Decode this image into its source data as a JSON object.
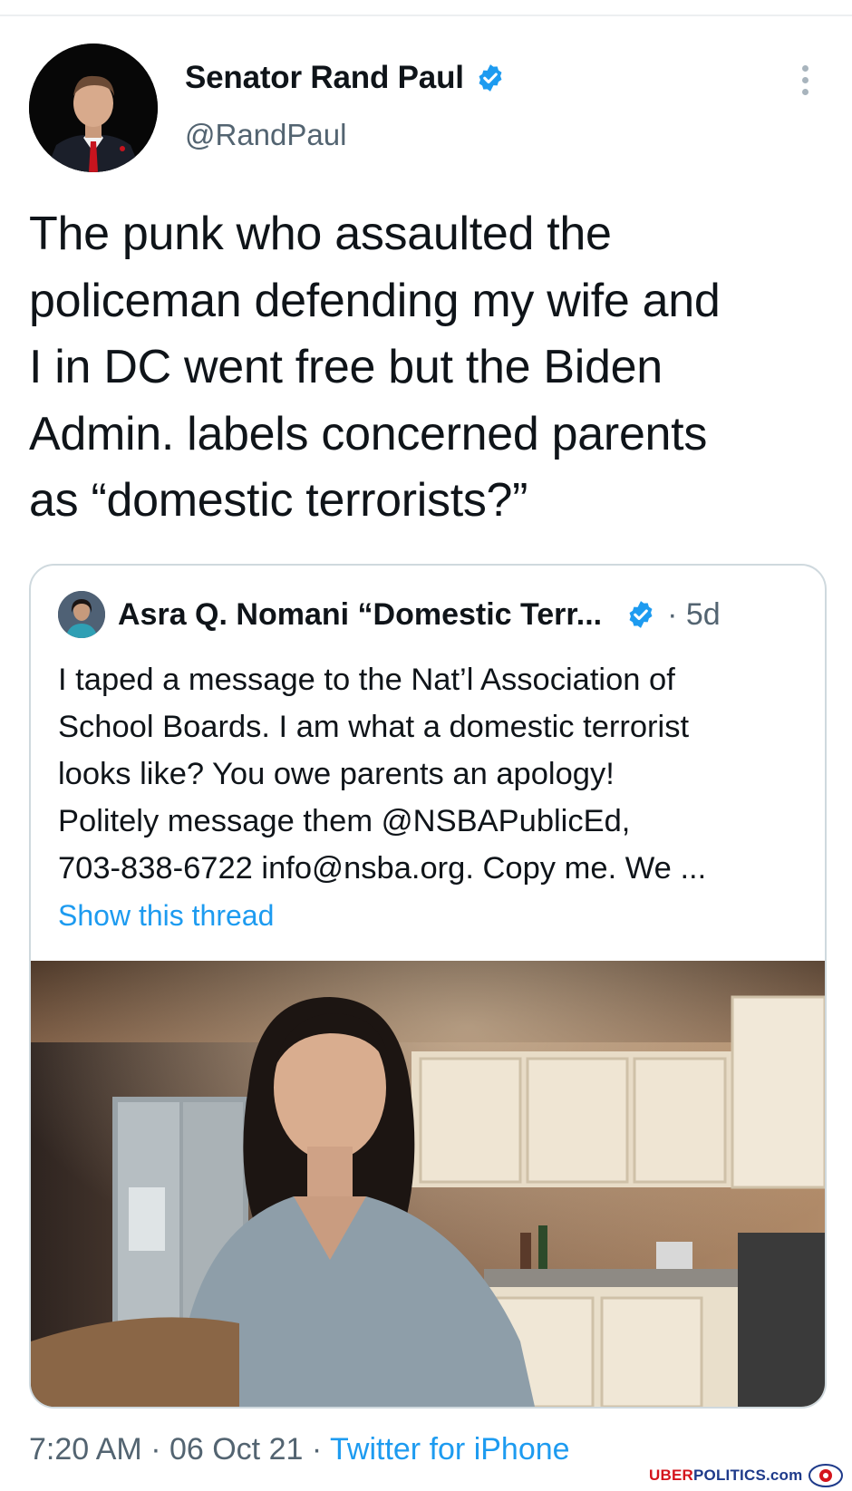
{
  "tweet": {
    "author": {
      "display_name": "Senator Rand Paul",
      "handle": "@RandPaul",
      "verified": true,
      "avatar_icon": "profile-photo"
    },
    "text_lines": [
      "The punk who assaulted the",
      "policeman defending my wife and",
      "I in DC went free but the Biden",
      "Admin. labels concerned parents",
      "as “domestic terrorists?”"
    ],
    "more_icon": "more-vertical-icon",
    "quoted": {
      "display_name": "Asra Q. Nomani “Domestic Terr...",
      "verified": true,
      "time": "· 5d",
      "text_lines": [
        "I taped a message to the Nat’l Association of",
        "School Boards. I am what a domestic terrorist",
        "looks like? You owe parents an apology!",
        "Politely message them @NSBAPublicEd,",
        "703-838-6722 info@nsba.org. Copy me. We ..."
      ],
      "show_thread": "Show this thread",
      "media": "video-frame-kitchen"
    },
    "meta": {
      "time": "7:20 AM",
      "sep1": " · ",
      "date": "06 Oct 21",
      "sep2": " · ",
      "source": "Twitter for iPhone"
    }
  },
  "watermark": {
    "brand_red": "UBER",
    "brand_blue": "POLITICS",
    "suffix": ".com"
  },
  "colors": {
    "text": "#0f1419",
    "secondary": "#536471",
    "accent_blue": "#1d9bf0",
    "border": "#cfd9de"
  }
}
